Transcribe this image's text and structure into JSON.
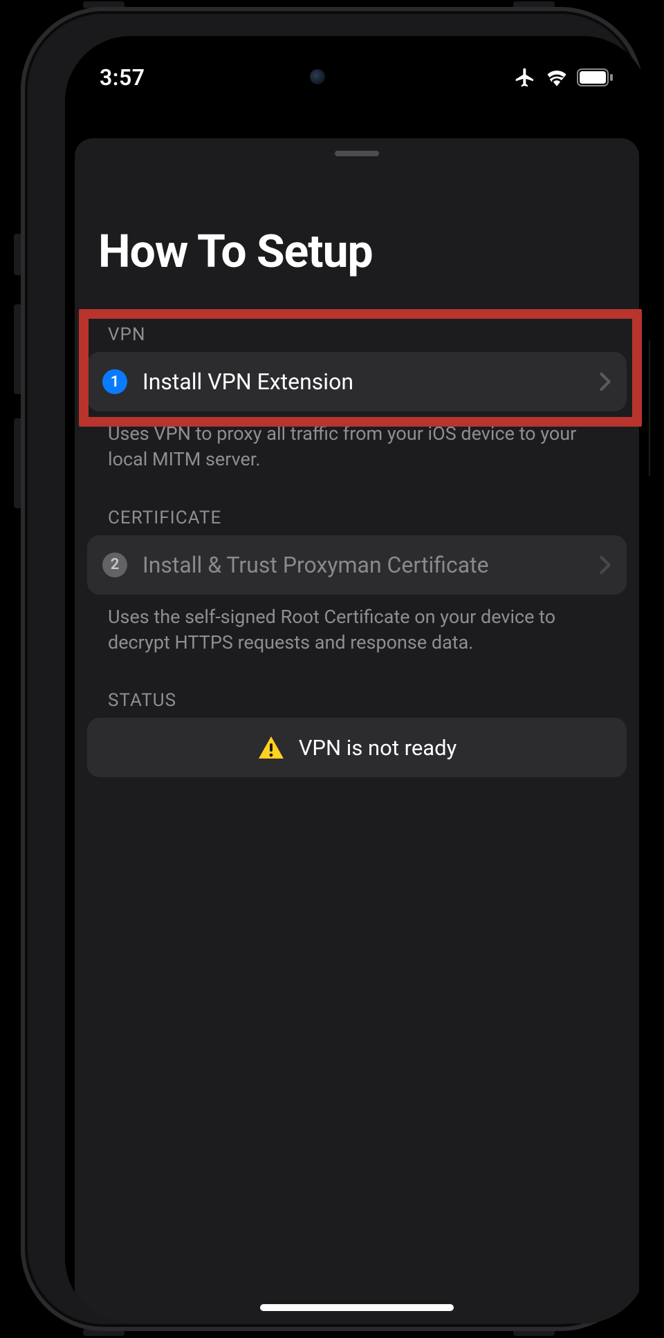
{
  "status_bar": {
    "time": "3:57"
  },
  "sheet": {
    "title": "How To Setup"
  },
  "sections": {
    "vpn": {
      "header": "VPN",
      "step_number": "1",
      "row_label": "Install VPN Extension",
      "footer": "Uses VPN to proxy all traffic from your iOS device to your local MITM server."
    },
    "certificate": {
      "header": "CERTIFICATE",
      "step_number": "2",
      "row_label": "Install & Trust Proxyman Certificate",
      "footer": "Uses the self-signed Root Certificate on your device to decrypt HTTPS requests and response data."
    },
    "status": {
      "header": "STATUS",
      "message": "VPN is not ready"
    }
  }
}
